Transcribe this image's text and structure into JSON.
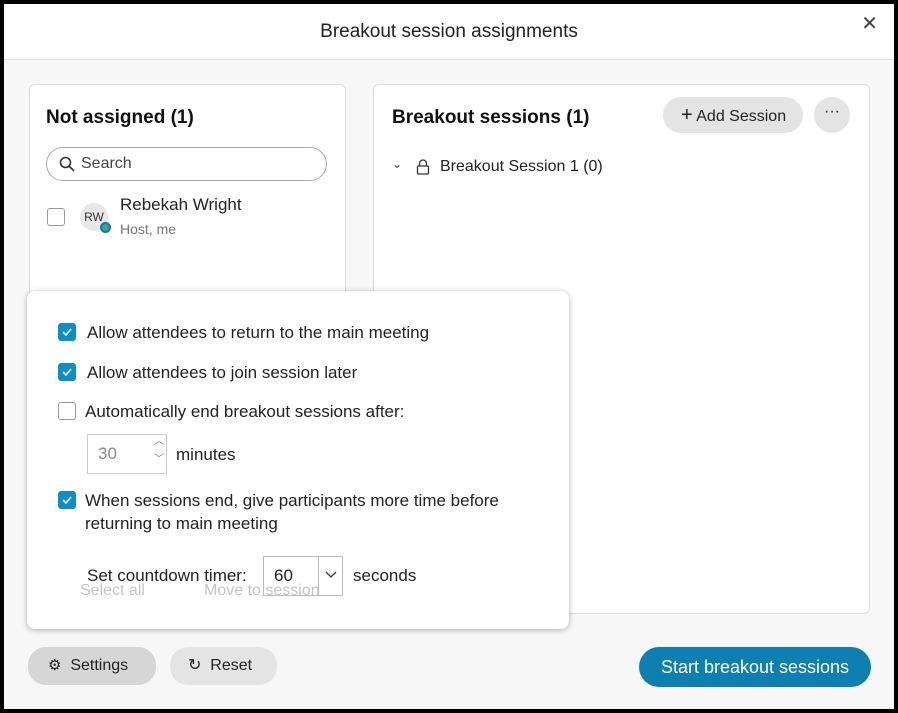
{
  "title": "Breakout session assignments",
  "not_assigned": {
    "heading": "Not assigned (1)",
    "search_placeholder": "Search",
    "participants": [
      {
        "initials": "RW",
        "name": "Rebekah Wright",
        "role": "Host, me",
        "checked": false
      }
    ],
    "select_all": "Select all",
    "move_to_session": "Move to session"
  },
  "sessions": {
    "heading": "Breakout sessions  (1)",
    "add_label": "Add Session",
    "items": [
      {
        "name": "Breakout Session 1 (0)",
        "locked": true,
        "expanded": true
      }
    ]
  },
  "settings_popover": {
    "opt1": {
      "label": "Allow attendees to return to the main meeting",
      "checked": true
    },
    "opt2": {
      "label": "Allow attendees to join session later",
      "checked": true
    },
    "opt3": {
      "label": "Automatically end breakout sessions after:",
      "checked": false
    },
    "minutes_value": "30",
    "minutes_label": "minutes",
    "opt4": {
      "label1": "When sessions end, give participants more time before",
      "label2": "returning to main meeting",
      "checked": true
    },
    "countdown_label": "Set countdown timer:",
    "countdown_value": "60",
    "seconds_label": "seconds"
  },
  "footer": {
    "settings": "Settings",
    "reset": "Reset",
    "start": "Start breakout sessions"
  },
  "colors": {
    "accent": "#0d7fb0",
    "checkbox": "#0d8fc6"
  }
}
